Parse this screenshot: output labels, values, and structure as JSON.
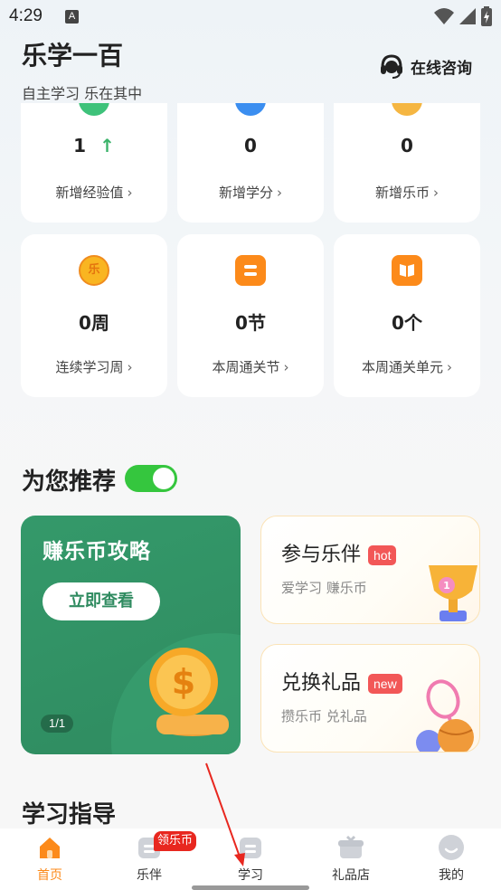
{
  "status_bar": {
    "time": "4:29",
    "notification_letter": "A"
  },
  "header": {
    "title": "乐学一百",
    "slogan": "自主学习 乐在其中",
    "consult_label": "在线咨询"
  },
  "stats_row1": [
    {
      "value": "1",
      "label": "新增经验值",
      "trend": "↑"
    },
    {
      "value": "0",
      "label": "新增学分"
    },
    {
      "value": "0",
      "label": "新增乐币"
    }
  ],
  "stats_row2": [
    {
      "value": "0周",
      "label": "连续学习周",
      "icon_text": "乐"
    },
    {
      "value": "0节",
      "label": "本周通关节"
    },
    {
      "value": "0个",
      "label": "本周通关单元"
    }
  ],
  "recommend": {
    "title": "为您推荐",
    "toggle_on": true,
    "banner": {
      "title": "赚乐币攻略",
      "button": "立即查看",
      "page": "1/1"
    },
    "cards": [
      {
        "title": "参与乐伴",
        "tag": "hot",
        "subtitle": "爱学习 赚乐币"
      },
      {
        "title": "兑换礼品",
        "tag": "new",
        "subtitle": "攒乐币 兑礼品"
      }
    ]
  },
  "guide": {
    "title": "学习指导"
  },
  "tab_bar": {
    "tabs": [
      {
        "label": "首页",
        "active": true
      },
      {
        "label": "乐伴",
        "badge": "领乐币"
      },
      {
        "label": "学习"
      },
      {
        "label": "礼品店"
      },
      {
        "label": "我的"
      }
    ]
  },
  "colors": {
    "accent_orange": "#fc8a1a",
    "green": "#35c63e",
    "banner_green": "#2f8b60",
    "tag_red": "#f25757",
    "badge_red": "#e8271f"
  }
}
